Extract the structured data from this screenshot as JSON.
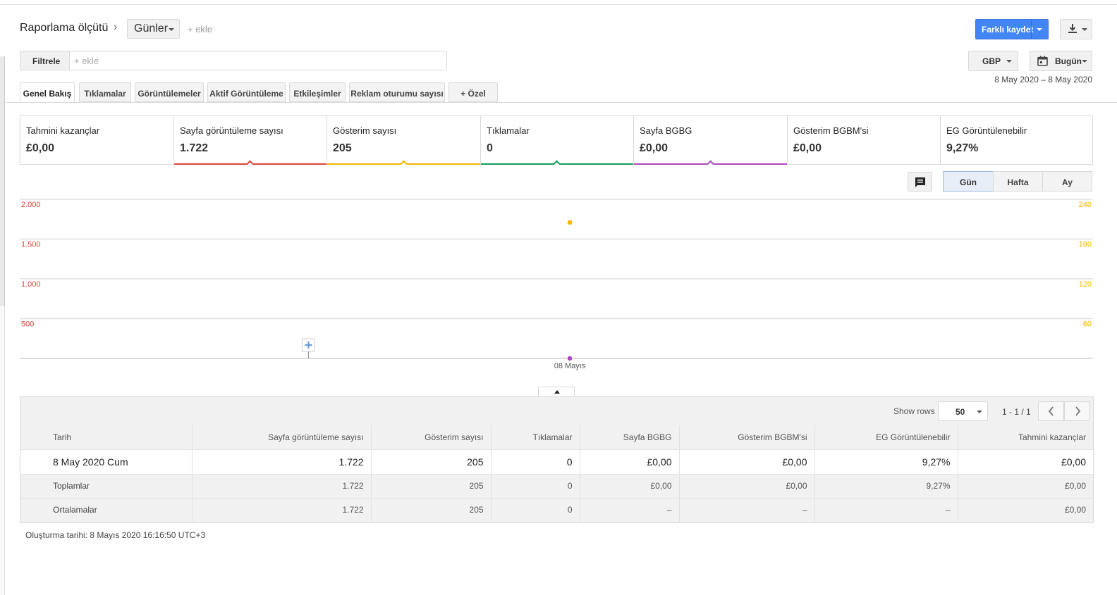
{
  "header": {
    "title": "Raporlama ölçütü",
    "chevron": "›",
    "dimension": "Günler",
    "add_label": "+ ekle",
    "save_label": "Farklı kaydet",
    "download_icon": "download-icon"
  },
  "filter": {
    "label": "Filtrele",
    "placeholder": "+ ekle"
  },
  "controls": {
    "currency": "GBP",
    "date_label": "Bugün",
    "date_range": "8 May 2020 – 8 May 2020"
  },
  "tabs": [
    {
      "label": "Genel Bakış",
      "active": true
    },
    {
      "label": "Tıklamalar"
    },
    {
      "label": "Görüntülemeler"
    },
    {
      "label": "Aktif Görüntüleme"
    },
    {
      "label": "Etkileşimler"
    },
    {
      "label": "Reklam oturumu sayısı"
    },
    {
      "label": "+ Özel"
    }
  ],
  "scorecards": [
    {
      "name": "Tahmini kazançlar",
      "value": "£0,00",
      "color": ""
    },
    {
      "name": "Sayfa görüntüleme sayısı",
      "value": "1.722",
      "color": "#db4437"
    },
    {
      "name": "Gösterim sayısı",
      "value": "205",
      "color": "#f4b400"
    },
    {
      "name": "Tıklamalar",
      "value": "0",
      "color": "#0f9d58"
    },
    {
      "name": "Sayfa BGBG",
      "value": "£0,00",
      "color": "#ab47bc"
    },
    {
      "name": "Gösterim BGBM'si",
      "value": "£0,00",
      "color": ""
    },
    {
      "name": "EG Görüntülenebilir",
      "value": "9,27%",
      "color": ""
    }
  ],
  "granularity": {
    "day": "Gün",
    "week": "Hafta",
    "month": "Ay",
    "active": "day"
  },
  "chart_data": {
    "type": "line",
    "x": [
      "08 Mayıs"
    ],
    "left_axis": {
      "ticks": [
        "2.000",
        "1.500",
        "1.000",
        "500"
      ],
      "ticks_values": [
        2000,
        1500,
        1000,
        500
      ],
      "ylim": [
        0,
        2000
      ],
      "color": "#db4437"
    },
    "right_axis": {
      "ticks": [
        "240",
        "180",
        "120",
        "60"
      ],
      "ticks_values": [
        240,
        180,
        120,
        60
      ],
      "ylim": [
        0,
        240
      ],
      "color": "#f4b400"
    },
    "series": [
      {
        "name": "Gösterim sayısı",
        "axis": "right",
        "color": "#f4b400",
        "values": [
          205
        ]
      },
      {
        "name": "Sayfa BGBG",
        "axis": "right",
        "color": "#ab47bc",
        "values": [
          0
        ]
      }
    ],
    "grid": true
  },
  "table": {
    "show_rows_label": "Show rows",
    "rows_value": "50",
    "page_info": "1 - 1 / 1",
    "headers": [
      "Tarih",
      "Sayfa görüntüleme sayısı",
      "Gösterim sayısı",
      "Tıklamalar",
      "Sayfa BGBG",
      "Gösterim BGBM'si",
      "EG Görüntülenebilir",
      "Tahmini kazançlar"
    ],
    "rows": [
      [
        "8 May 2020 Cum",
        "1.722",
        "205",
        "0",
        "£0,00",
        "£0,00",
        "9,27%",
        "£0,00"
      ]
    ],
    "totals": [
      "Toplamlar",
      "1.722",
      "205",
      "0",
      "£0,00",
      "£0,00",
      "9,27%",
      "£0,00"
    ],
    "averages": [
      "Ortalamalar",
      "1.722",
      "205",
      "0",
      "–",
      "–",
      "–",
      "£0,00"
    ]
  },
  "footer": {
    "created": "Oluşturma tarihi: 8 Mayıs 2020 16:16:50 UTC+3"
  }
}
